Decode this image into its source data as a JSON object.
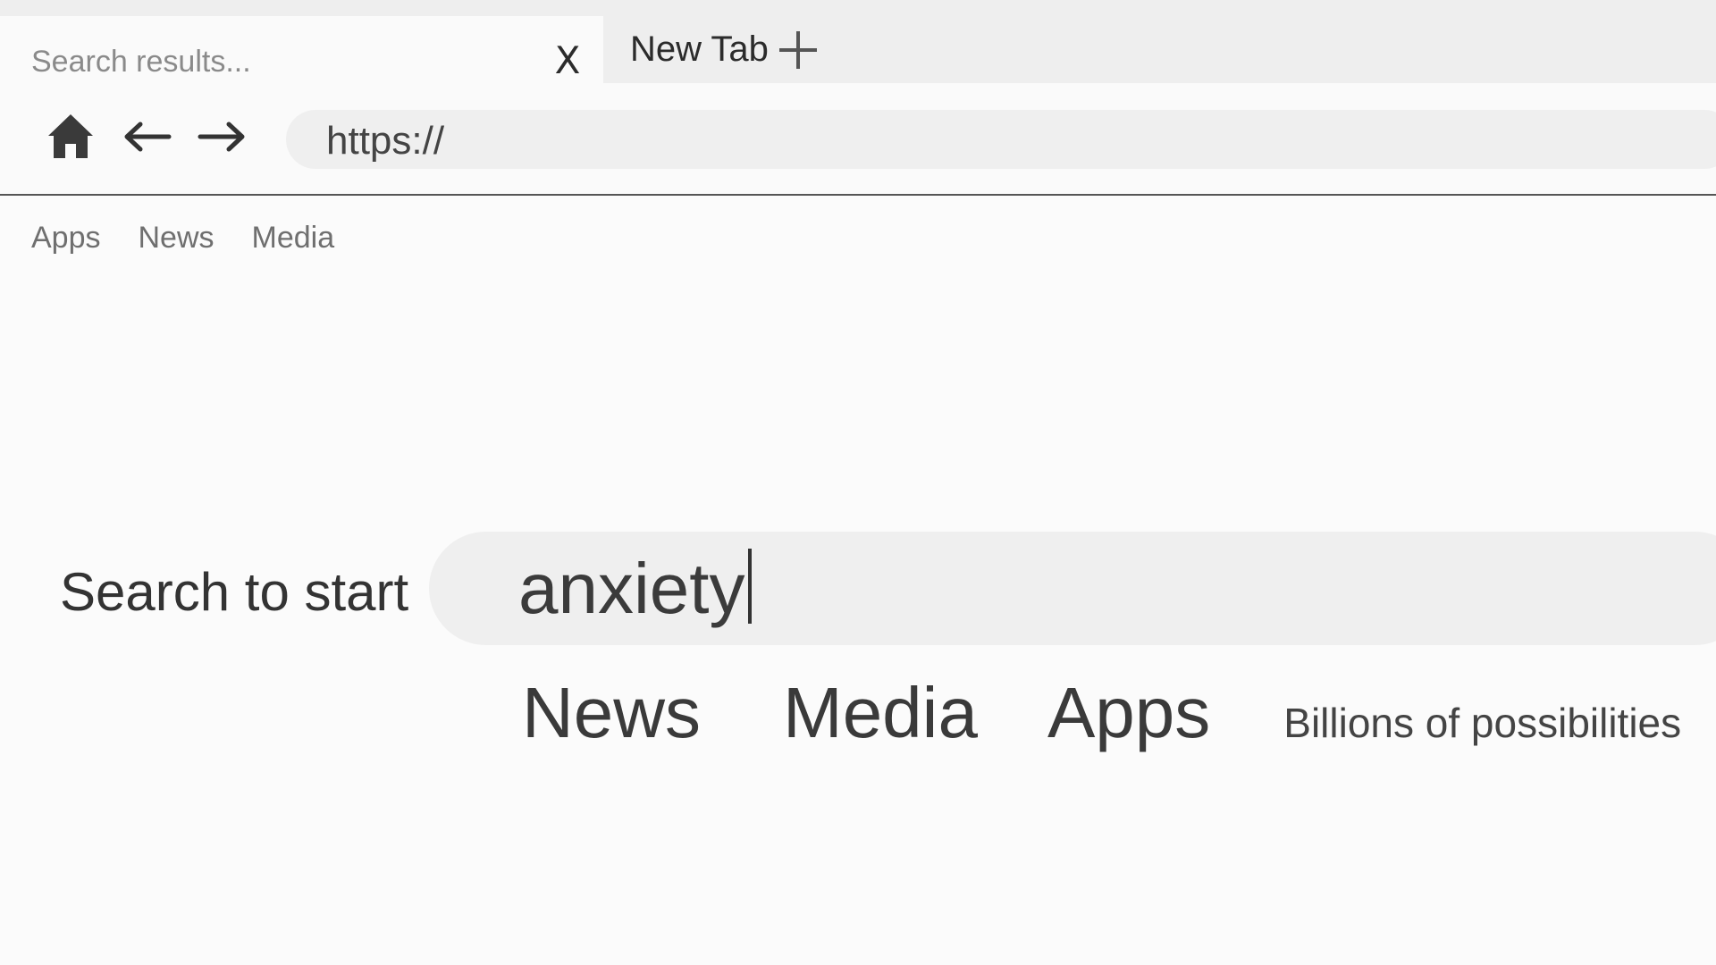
{
  "tabs": {
    "active": {
      "title": "Search results...",
      "close_label": "X"
    },
    "new_tab": {
      "label": "New Tab"
    }
  },
  "toolbar": {
    "home_icon": "home-icon",
    "back_icon": "arrow-left-icon",
    "forward_icon": "arrow-right-icon",
    "url": "https://"
  },
  "bookmarks": {
    "items": [
      {
        "label": "Apps"
      },
      {
        "label": "News"
      },
      {
        "label": "Media"
      }
    ]
  },
  "search": {
    "label": "Search to start",
    "value": "anxiety"
  },
  "categories": {
    "items": [
      {
        "label": "News"
      },
      {
        "label": "Media"
      },
      {
        "label": "Apps"
      }
    ],
    "tagline": "Billions of possibilities"
  },
  "colors": {
    "background": "#fbfbfb",
    "tab_strip": "#eeeeee",
    "field": "#efefef",
    "text_dark": "#333333",
    "text_muted": "#6f6f6f"
  }
}
